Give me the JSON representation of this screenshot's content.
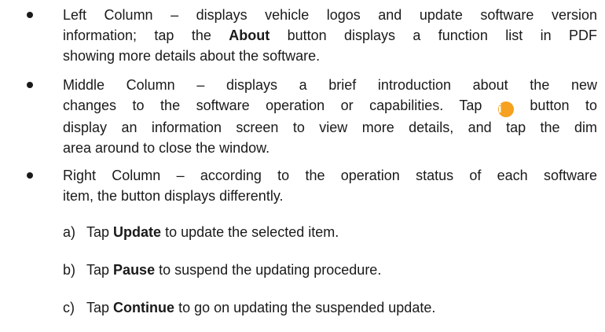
{
  "bullets": [
    {
      "lines": [
        "Left Column – displays vehicle logos and update software version",
        "information; tap the",
        "About",
        "button displays a function list in PDF",
        "showing more details about the software."
      ]
    },
    {
      "lines": [
        "Middle Column – displays a brief introduction about the new",
        "changes to the software operation or capabilities. Tap",
        "button to",
        "display an information screen to view more details, and tap the dim",
        "area around to close the window."
      ],
      "icon": "info-icon"
    },
    {
      "lines": [
        "Right Column – according to the operation status of each software",
        "item, the button displays differently."
      ]
    }
  ],
  "sub_items": [
    {
      "marker": "a)",
      "prefix": "Tap",
      "bold": "Update",
      "suffix": "to update the selected item."
    },
    {
      "marker": "b)",
      "prefix": "Tap",
      "bold": "Pause",
      "suffix": "to suspend the updating procedure."
    },
    {
      "marker": "c)",
      "prefix": "Tap",
      "bold": "Continue",
      "suffix": "to go on updating the suspended update."
    }
  ]
}
